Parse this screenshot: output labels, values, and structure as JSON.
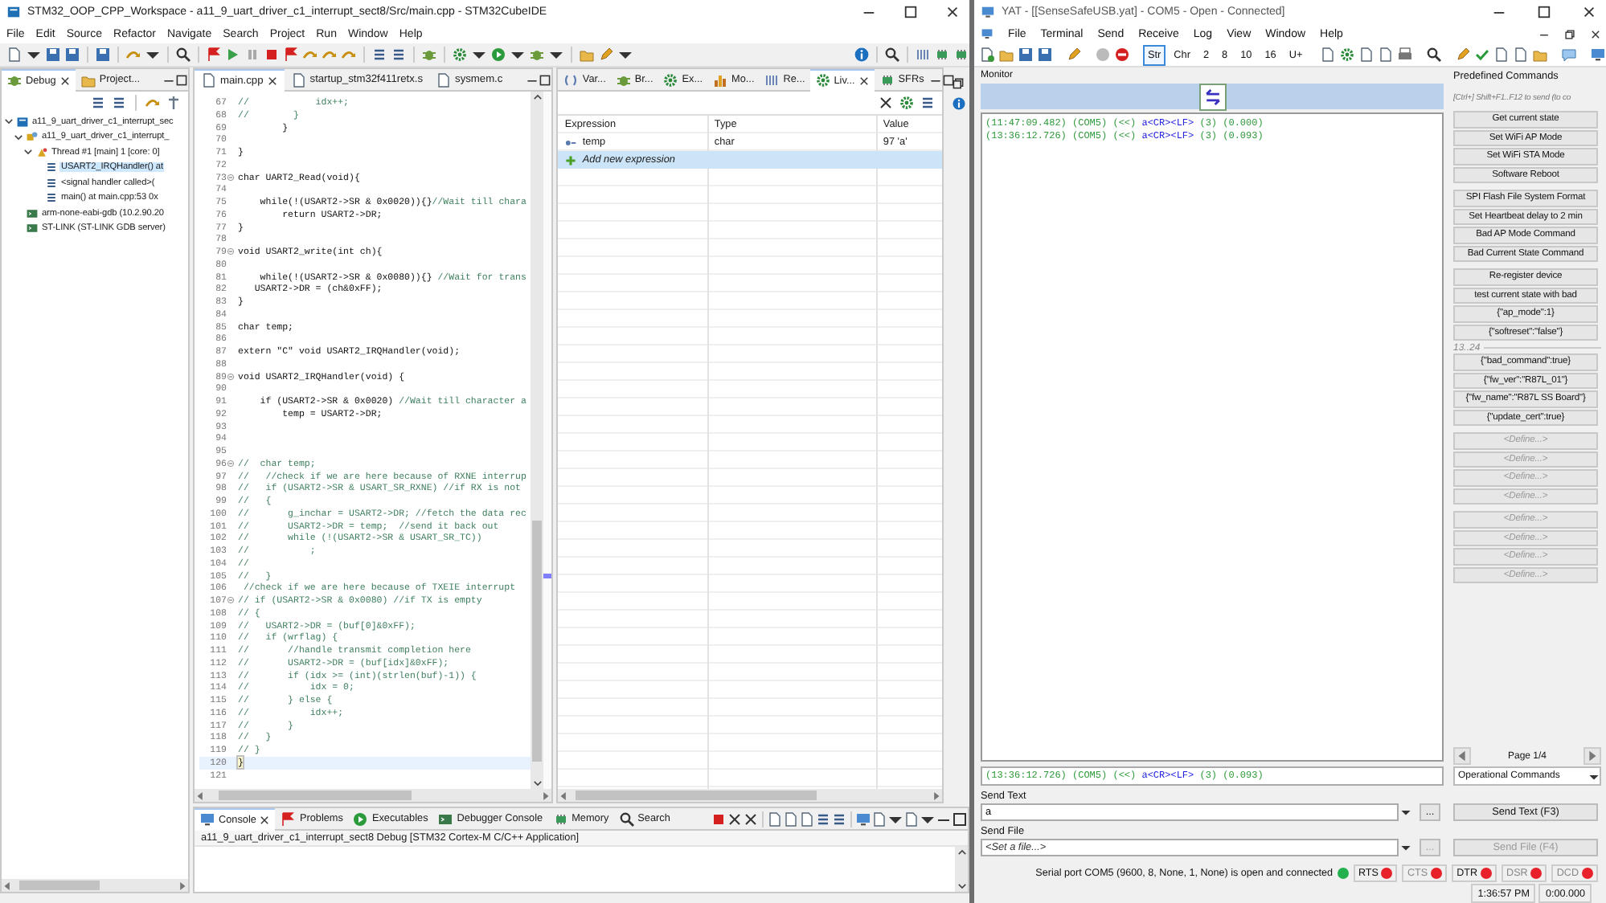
{
  "ide": {
    "title": "STM32_OOP_CPP_Workspace - a11_9_uart_driver_c1_interrupt_sect8/Src/main.cpp - STM32CubeIDE",
    "menu": [
      "File",
      "Edit",
      "Source",
      "Refactor",
      "Navigate",
      "Search",
      "Project",
      "Run",
      "Window",
      "Help"
    ],
    "debug_panel": {
      "tabs": [
        {
          "label": "Debug",
          "selected": true
        },
        {
          "label": "Project...",
          "selected": false
        }
      ],
      "tree": [
        {
          "kind": "project",
          "label": "a11_9_uart_driver_c1_interrupt_sec",
          "selected": false,
          "expanded": true,
          "children": [
            {
              "kind": "process",
              "label": "a11_9_uart_driver_c1_interrupt_",
              "selected": false,
              "expanded": true,
              "children": [
                {
                  "kind": "thread",
                  "label": "Thread #1 [main] 1 [core: 0]",
                  "selected": false,
                  "expanded": true,
                  "children": [
                    {
                      "kind": "frame",
                      "label": "USART2_IRQHandler() at",
                      "selected": true
                    },
                    {
                      "kind": "frame",
                      "label": "<signal handler called>(",
                      "selected": false
                    },
                    {
                      "kind": "frame",
                      "label": "main() at main.cpp:53 0x",
                      "selected": false
                    }
                  ]
                }
              ]
            },
            {
              "kind": "gdb",
              "label": "arm-none-eabi-gdb (10.2.90.20",
              "selected": false
            },
            {
              "kind": "gdb",
              "label": "ST-LINK (ST-LINK GDB server)",
              "selected": false
            }
          ]
        }
      ]
    },
    "editor": {
      "tabs": [
        {
          "label": "main.cpp",
          "selected": true
        },
        {
          "label": "startup_stm32f411retx.s",
          "selected": false
        },
        {
          "label": "sysmem.c",
          "selected": false
        }
      ],
      "lines": [
        {
          "number": "67",
          "comment": "//            idx++;",
          "fold": false,
          "current": false
        },
        {
          "number": "68",
          "comment": "//        }",
          "fold": false,
          "current": false
        },
        {
          "number": "69",
          "code": "        }",
          "fold": false,
          "current": false
        },
        {
          "number": "70",
          "fold": false,
          "current": false
        },
        {
          "number": "71",
          "code": "}",
          "fold": false,
          "current": false
        },
        {
          "number": "72",
          "fold": false,
          "current": false
        },
        {
          "number": "73",
          "code": "char UART2_Read(void){",
          "fold": true,
          "current": false
        },
        {
          "number": "74",
          "fold": false,
          "current": false
        },
        {
          "number": "75",
          "code": "    while(!(USART2->SR & 0x0020)){}",
          "comment": "//Wait till chara",
          "fold": false,
          "current": false
        },
        {
          "number": "76",
          "code": "        return USART2->DR;",
          "fold": false,
          "current": false
        },
        {
          "number": "77",
          "code": "}",
          "fold": false,
          "current": false
        },
        {
          "number": "78",
          "fold": false,
          "current": false
        },
        {
          "number": "79",
          "code": "void USART2_write(int ch){",
          "fold": true,
          "current": false
        },
        {
          "number": "80",
          "fold": false,
          "current": false
        },
        {
          "number": "81",
          "code": "    while(!(USART2->SR & 0x0080)){} ",
          "comment": "//Wait for trans",
          "fold": false,
          "current": false
        },
        {
          "number": "82",
          "code": "   USART2->DR = (ch&0xFF);",
          "fold": false,
          "current": false
        },
        {
          "number": "83",
          "code": "}",
          "fold": false,
          "current": false
        },
        {
          "number": "84",
          "fold": false,
          "current": false
        },
        {
          "number": "85",
          "code": "char temp;",
          "fold": false,
          "current": false
        },
        {
          "number": "86",
          "fold": false,
          "current": false
        },
        {
          "number": "87",
          "code": "extern \"C\" void USART2_IRQHandler(void);",
          "fold": false,
          "current": false
        },
        {
          "number": "88",
          "fold": false,
          "current": false
        },
        {
          "number": "89",
          "code": "void USART2_IRQHandler(void) {",
          "fold": true,
          "current": false
        },
        {
          "number": "90",
          "fold": false,
          "current": false
        },
        {
          "number": "91",
          "code": "    if (USART2->SR & 0x0020) ",
          "comment": "//Wait till character a",
          "fold": false,
          "current": false
        },
        {
          "number": "92",
          "code": "        temp = USART2->DR;",
          "fold": false,
          "current": false
        },
        {
          "number": "93",
          "fold": false,
          "current": false
        },
        {
          "number": "94",
          "fold": false,
          "current": false
        },
        {
          "number": "95",
          "fold": false,
          "current": false
        },
        {
          "number": "96",
          "comment": "//  char temp;",
          "fold": true,
          "current": false
        },
        {
          "number": "97",
          "comment": "//   //check if we are here because of RXNE interrup",
          "fold": false,
          "current": false
        },
        {
          "number": "98",
          "comment": "//   if (USART2->SR & USART_SR_RXNE) //if RX is not",
          "fold": false,
          "current": false
        },
        {
          "number": "99",
          "comment": "//   {",
          "fold": false,
          "current": false
        },
        {
          "number": "100",
          "comment": "//       g_inchar = USART2->DR; //fetch the data rec",
          "fold": false,
          "current": false
        },
        {
          "number": "101",
          "comment": "//       USART2->DR = temp;  //send it back out",
          "fold": false,
          "current": false
        },
        {
          "number": "102",
          "comment": "//       while (!(USART2->SR & USART_SR_TC))",
          "fold": false,
          "current": false
        },
        {
          "number": "103",
          "comment": "//           ;",
          "fold": false,
          "current": false
        },
        {
          "number": "104",
          "comment": "//",
          "fold": false,
          "current": false
        },
        {
          "number": "105",
          "comment": "//   }",
          "fold": false,
          "current": false
        },
        {
          "number": "106",
          "comment": " //check if we are here because of TXEIE interrupt",
          "fold": false,
          "current": false
        },
        {
          "number": "107",
          "comment": "// if (USART2->SR & 0x0080) //if TX is empty",
          "fold": true,
          "current": false
        },
        {
          "number": "108",
          "comment": "// {",
          "fold": false,
          "current": false
        },
        {
          "number": "109",
          "comment": "//   USART2->DR = (buf[0]&0xFF);",
          "fold": false,
          "current": false
        },
        {
          "number": "110",
          "comment": "//   if (wrflag) {",
          "fold": false,
          "current": false
        },
        {
          "number": "111",
          "comment": "//       //handle transmit completion here",
          "fold": false,
          "current": false
        },
        {
          "number": "112",
          "comment": "//       USART2->DR = (buf[idx]&0xFF);",
          "fold": false,
          "current": false
        },
        {
          "number": "113",
          "comment": "//       if (idx >= (int)(strlen(buf)-1)) {",
          "fold": false,
          "current": false
        },
        {
          "number": "114",
          "comment": "//           idx = 0;",
          "fold": false,
          "current": false
        },
        {
          "number": "115",
          "comment": "//       } else {",
          "fold": false,
          "current": false
        },
        {
          "number": "116",
          "comment": "//           idx++;",
          "fold": false,
          "current": false
        },
        {
          "number": "117",
          "comment": "//       }",
          "fold": false,
          "current": false
        },
        {
          "number": "118",
          "comment": "//   }",
          "fold": false,
          "current": false
        },
        {
          "number": "119",
          "comment": "// }",
          "fold": false,
          "current": false
        },
        {
          "number": "120",
          "code": "}",
          "fold": false,
          "current": true
        },
        {
          "number": "121",
          "fold": false,
          "current": false
        }
      ]
    },
    "expressions": {
      "tabs": [
        {
          "label": "Var...",
          "selected": false
        },
        {
          "label": "Br...",
          "selected": false
        },
        {
          "label": "Ex...",
          "selected": false
        },
        {
          "label": "Mo...",
          "selected": false
        },
        {
          "label": "Re...",
          "selected": false
        },
        {
          "label": "Liv...",
          "selected": true
        },
        {
          "label": "SFRs",
          "selected": false
        }
      ],
      "columns": [
        "Expression",
        "Type",
        "Value"
      ],
      "rows": [
        {
          "kind": "variable",
          "cells": [
            "temp",
            "char",
            "97 'a'"
          ],
          "selected": false
        },
        {
          "kind": "add",
          "cells": [
            "Add new expression"
          ],
          "selected": true
        }
      ]
    },
    "console": {
      "tabs": [
        {
          "label": "Console",
          "selected": true
        },
        {
          "label": "Problems",
          "selected": false
        },
        {
          "label": "Executables",
          "selected": false
        },
        {
          "label": "Debugger Console",
          "selected": false
        },
        {
          "label": "Memory",
          "selected": false
        },
        {
          "label": "Search",
          "selected": false
        }
      ],
      "text": "a11_9_uart_driver_c1_interrupt_sect8 Debug [STM32 Cortex-M C/C++ Application]"
    }
  },
  "yat": {
    "title": "YAT - [[SenseSafeUSB.yat] - COM5 - Open - Connected]",
    "menu": [
      "File",
      "Terminal",
      "Send",
      "Receive",
      "Log",
      "View",
      "Window",
      "Help"
    ],
    "radix": [
      {
        "label": "Str",
        "selected": true
      },
      {
        "label": "Chr",
        "selected": false
      },
      {
        "label": "2",
        "selected": false
      },
      {
        "label": "8",
        "selected": false
      },
      {
        "label": "10",
        "selected": false
      },
      {
        "label": "16",
        "selected": false
      },
      {
        "label": "U+",
        "selected": false
      }
    ],
    "monitor": {
      "title": "Monitor",
      "lines": [
        [
          {
            "kind": "info",
            "text": "(11:47:09.482) (COM5) (<<) "
          },
          {
            "kind": "data",
            "text": "a<CR><LF>"
          },
          {
            "kind": "info",
            "text": " (3) (0.000)"
          }
        ],
        [
          {
            "kind": "info",
            "text": "(13:36:12.726) (COM5) (<<) "
          },
          {
            "kind": "data",
            "text": "a<CR><LF>"
          },
          {
            "kind": "info",
            "text": " (3) (0.093)"
          }
        ]
      ],
      "last_line": [
        {
          "kind": "info",
          "text": "(13:36:12.726) (COM5) (<<) "
        },
        {
          "kind": "data",
          "text": "a<CR><LF>"
        },
        {
          "kind": "info",
          "text": " (3) (0.093)"
        }
      ]
    },
    "predefined": {
      "title": "Predefined Commands",
      "hint": "[Ctrl+] Shift+F1..F12 to send (to co",
      "groups": [
        {
          "commands": [
            {
              "label": "Get current state",
              "disabled": false
            },
            {
              "label": "Set WiFi AP Mode",
              "disabled": false
            },
            {
              "label": "Set WiFi STA Mode",
              "disabled": false
            },
            {
              "label": "Software Reboot",
              "disabled": false
            }
          ]
        },
        {
          "commands": [
            {
              "label": "SPI Flash File System Format",
              "disabled": false
            },
            {
              "label": "Set Heartbeat delay to 2 min",
              "disabled": false
            },
            {
              "label": "Bad AP Mode Command",
              "disabled": false
            },
            {
              "label": "Bad Current State Command",
              "disabled": false
            }
          ]
        },
        {
          "commands": [
            {
              "label": "Re-register device",
              "disabled": false
            },
            {
              "label": "test current state with bad",
              "disabled": false
            },
            {
              "label": "{\"ap_mode\":1}",
              "disabled": false
            },
            {
              "label": "{\"softreset\":\"false\"}",
              "disabled": false
            }
          ]
        },
        {
          "label": "13..24",
          "commands": [
            {
              "label": "{\"bad_command\":true}",
              "disabled": false
            },
            {
              "label": "{\"fw_ver\":\"R87L_01\"}",
              "disabled": false
            },
            {
              "label": "{\"fw_name\":\"R87L SS Board\"}",
              "disabled": false
            },
            {
              "label": "{\"update_cert\":true}",
              "disabled": false
            }
          ]
        },
        {
          "commands": [
            {
              "label": "<Define...>",
              "disabled": true
            },
            {
              "label": "<Define...>",
              "disabled": true
            },
            {
              "label": "<Define...>",
              "disabled": true
            },
            {
              "label": "<Define...>",
              "disabled": true
            }
          ]
        },
        {
          "commands": [
            {
              "label": "<Define...>",
              "disabled": true
            },
            {
              "label": "<Define...>",
              "disabled": true
            },
            {
              "label": "<Define...>",
              "disabled": true
            },
            {
              "label": "<Define...>",
              "disabled": true
            }
          ]
        }
      ],
      "page": "Page 1/4",
      "set": "Operational Commands"
    },
    "send_text": {
      "label": "Send Text",
      "value": "a",
      "browse": "...",
      "button": "Send Text (F3)",
      "disabled": false
    },
    "send_file": {
      "label": "Send File",
      "placeholder": "<Set a file...>",
      "browse": "...",
      "button": "Send File (F4)",
      "disabled": true
    },
    "status": {
      "text": "Serial port COM5 (9600, 8, None, 1, None) is open and connected",
      "color": "#22b14c",
      "indicators": [
        {
          "label": "RTS",
          "color": "#e8202a",
          "active": true
        },
        {
          "label": "CTS",
          "color": "#e8202a",
          "active": false
        },
        {
          "label": "DTR",
          "color": "#e8202a",
          "active": true
        },
        {
          "label": "DSR",
          "color": "#e8202a",
          "active": false
        },
        {
          "label": "DCD",
          "color": "#e8202a",
          "active": false
        }
      ]
    },
    "clock": "1:36:57 PM",
    "elapsed": "0:00.000"
  }
}
